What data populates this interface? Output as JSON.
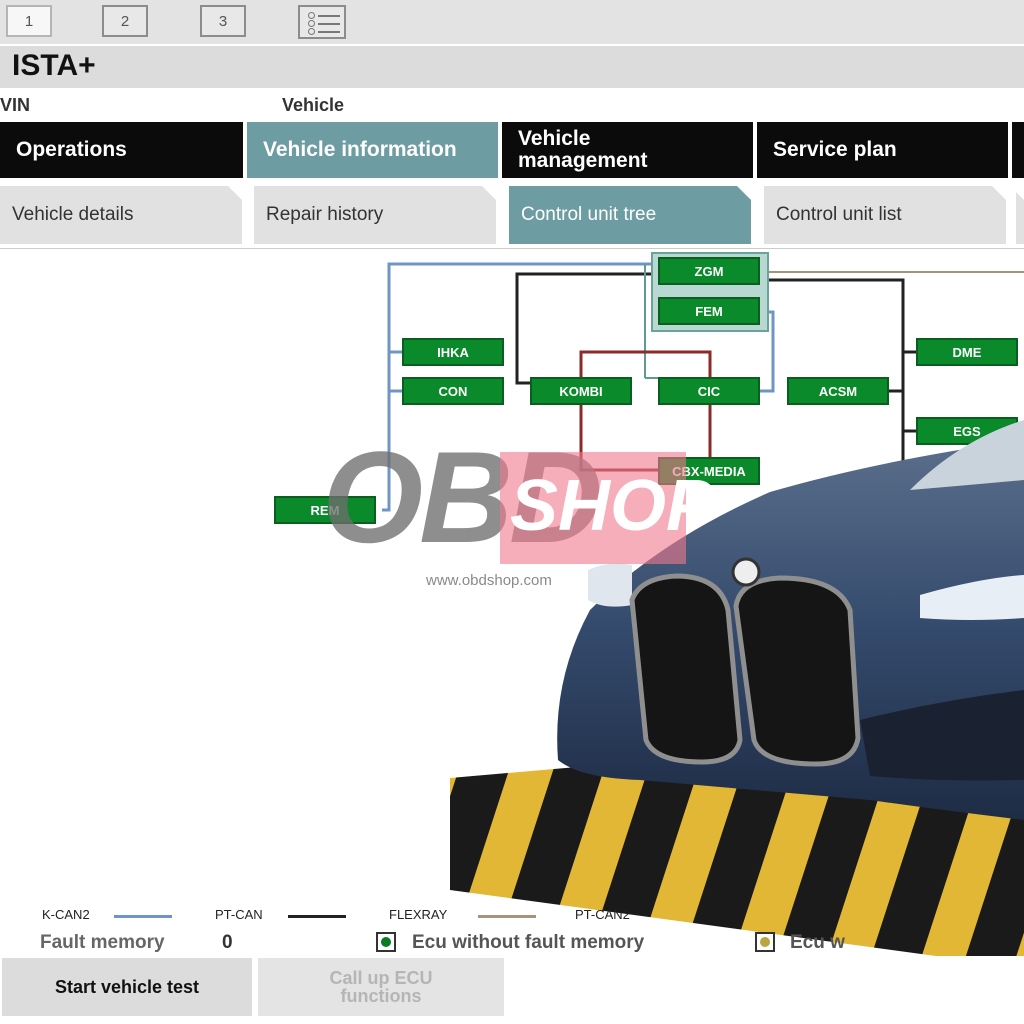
{
  "top_tabs": [
    "1",
    "2",
    "3"
  ],
  "app": {
    "title": "ISTA+"
  },
  "vin_row": {
    "vin_label": "VIN",
    "vehicle_label": "Vehicle"
  },
  "main_tabs": [
    "Operations",
    "Vehicle information",
    "Vehicle management",
    "Service plan"
  ],
  "sub_tabs": [
    "Vehicle details",
    "Repair history",
    "Control unit tree",
    "Control unit list"
  ],
  "ecus": [
    "ZGM",
    "FEM",
    "IHKA",
    "CON",
    "KOMBI",
    "CIC",
    "ACSM",
    "DME",
    "EGS",
    "CBX-MEDIA",
    "REM"
  ],
  "legend": [
    {
      "label": "K-CAN2",
      "color": "#6f95c6"
    },
    {
      "label": "PT-CAN",
      "color": "#222222"
    },
    {
      "label": "FLEXRAY",
      "color": "#a8927a"
    },
    {
      "label": "PT-CAN2",
      "color": "#8b2a2a"
    }
  ],
  "fault_memory": {
    "label": "Fault memory",
    "value": "0"
  },
  "status_legend": [
    {
      "label": "Ecu without fault memory",
      "color": "#0a7a25"
    },
    {
      "label": "Ecu w",
      "color": "#b9a640"
    }
  ],
  "buttons": {
    "start_test": "Start vehicle test",
    "call_up": "Call up ECU functions"
  },
  "watermark": {
    "obd": "OBD",
    "shop": "SHOP",
    "url": "www.obdshop.com"
  },
  "colors": {
    "ecu_green": "#0a8a2a",
    "active_tab": "#6d9ca2",
    "main_tab_bg": "#0b0b0b"
  }
}
